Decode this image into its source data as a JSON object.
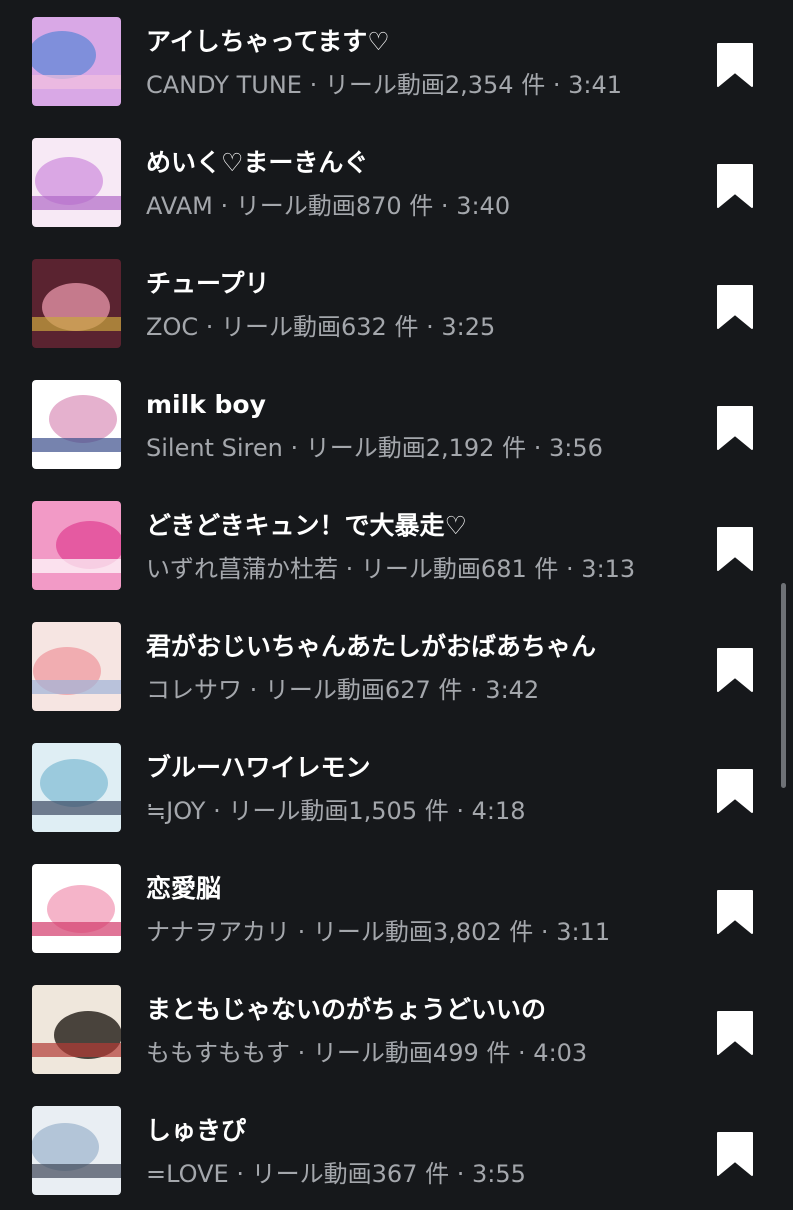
{
  "tracks": [
    {
      "title": "アイしちゃってます♡",
      "artist": "CANDY TUNE",
      "reels_label": "リール動画",
      "reels_count": "2,354",
      "unit": "件",
      "duration": "3:41",
      "cover_colors": [
        "#d9a8e6",
        "#6f8bd8",
        "#f2c1de"
      ]
    },
    {
      "title": "めいく♡まーきんぐ",
      "artist": "AVAM",
      "reels_label": "リール動画",
      "reels_count": "870",
      "unit": "件",
      "duration": "3:40",
      "cover_colors": [
        "#f7e9f5",
        "#d59be0",
        "#b169c7"
      ]
    },
    {
      "title": "チュープリ",
      "artist": "ZOC",
      "reels_label": "リール動画",
      "reels_count": "632",
      "unit": "件",
      "duration": "3:25",
      "cover_colors": [
        "#5a2330",
        "#d8899c",
        "#c9a63e"
      ]
    },
    {
      "title": "milk boy",
      "artist": "Silent Siren",
      "reels_label": "リール動画",
      "reels_count": "2,192",
      "unit": "件",
      "duration": "3:56",
      "cover_colors": [
        "#ffffff",
        "#e0a3c6",
        "#3c4f8c"
      ]
    },
    {
      "title": "どきどきキュン！で大暴走♡",
      "artist": "いずれ菖蒲か杜若",
      "reels_label": "リール動画",
      "reels_count": "681",
      "unit": "件",
      "duration": "3:13",
      "cover_colors": [
        "#f29ac6",
        "#e34f9a",
        "#ffffff"
      ]
    },
    {
      "title": "君がおじいちゃんあたしがおばあちゃん",
      "artist": "コレサワ",
      "reels_label": "リール動画",
      "reels_count": "627",
      "unit": "件",
      "duration": "3:42",
      "cover_colors": [
        "#f6e5e2",
        "#f0a3a8",
        "#9fb4d8"
      ]
    },
    {
      "title": "ブルーハワイレモン",
      "artist": "≒JOY",
      "reels_label": "リール動画",
      "reels_count": "1,505",
      "unit": "件",
      "duration": "4:18",
      "cover_colors": [
        "#dfeef4",
        "#8fc3d8",
        "#3d4a63"
      ]
    },
    {
      "title": "恋愛脳",
      "artist": "ナナヲアカリ",
      "reels_label": "リール動画",
      "reels_count": "3,802",
      "unit": "件",
      "duration": "3:11",
      "cover_colors": [
        "#ffffff",
        "#f3a7c0",
        "#d33a6b"
      ]
    },
    {
      "title": "まともじゃないのがちょうどいいの",
      "artist": "ももすももす",
      "reels_label": "リール動画",
      "reels_count": "499",
      "unit": "件",
      "duration": "4:03",
      "cover_colors": [
        "#efe7dc",
        "#2c2620",
        "#b23a34"
      ]
    },
    {
      "title": "しゅきぴ",
      "artist": "=LOVE",
      "reels_label": "リール動画",
      "reels_count": "367",
      "unit": "件",
      "duration": "3:55",
      "cover_colors": [
        "#e9eef3",
        "#a9bdd2",
        "#3e4758"
      ]
    }
  ],
  "separator": "·",
  "bookmark_icon": "bookmark-icon",
  "colors": {
    "background": "#16181b",
    "title": "#ffffff",
    "subtitle": "#a4a7ac",
    "bookmark": "#ffffff"
  }
}
